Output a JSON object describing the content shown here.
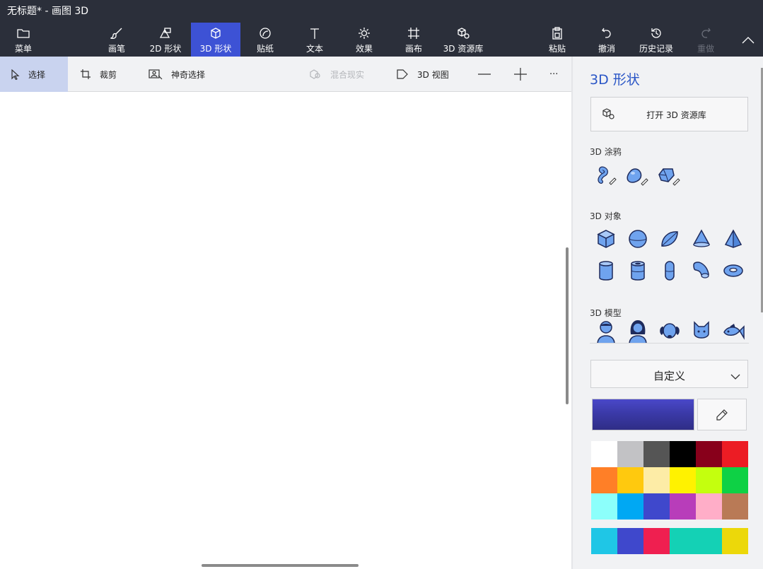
{
  "window": {
    "title": "无标题* - 画图 3D"
  },
  "ribbon": {
    "menu": {
      "label": "菜单",
      "icon": "folder-icon"
    },
    "brushes": {
      "label": "画笔",
      "icon": "brush-icon"
    },
    "shapes2d": {
      "label": "2D 形状",
      "icon": "shapes-2d-icon"
    },
    "shapes3d": {
      "label": "3D 形状",
      "icon": "cube-icon",
      "active": true
    },
    "stickers": {
      "label": "贴纸",
      "icon": "sticker-icon"
    },
    "text": {
      "label": "文本",
      "icon": "text-icon"
    },
    "effects": {
      "label": "效果",
      "icon": "sun-icon"
    },
    "canvas": {
      "label": "画布",
      "icon": "canvas-grid-icon"
    },
    "library3d": {
      "label": "3D 资源库",
      "icon": "library-3d-icon"
    },
    "paste": {
      "label": "粘贴",
      "icon": "clipboard-icon"
    },
    "undo": {
      "label": "撤消",
      "icon": "undo-icon"
    },
    "history": {
      "label": "历史记录",
      "icon": "history-icon"
    },
    "redo": {
      "label": "重做",
      "icon": "redo-icon",
      "disabled": true
    },
    "collapse": {
      "icon": "chevron-up-icon"
    }
  },
  "toolbar": {
    "select": "选择",
    "crop": "裁剪",
    "magic_select": "神奇选择",
    "mixed_reality": "混合现实",
    "view3d": "3D 视图",
    "more": "···"
  },
  "panel": {
    "title": "3D 形状",
    "open_library": "打开 3D 资源库",
    "doodles_label": "3D 涂鸦",
    "objects_label": "3D 对象",
    "models_label": "3D 模型",
    "doodles": [
      "tube-doodle-icon",
      "soft-edge-doodle-icon",
      "sharp-edge-doodle-icon"
    ],
    "objects_row1": [
      "cube-icon",
      "sphere-icon",
      "hemisphere-icon",
      "cone-icon",
      "pyramid-icon"
    ],
    "objects_row2": [
      "cylinder-icon",
      "tube-icon",
      "capsule-icon",
      "elbow-icon",
      "donut-icon"
    ],
    "models": [
      "man-model-icon",
      "woman-model-icon",
      "dog-model-icon",
      "cat-model-icon",
      "fish-model-icon"
    ],
    "material": "自定义",
    "current_color": "#3b3aa8",
    "palette": [
      "#ffffff",
      "#c2c2c5",
      "#555555",
      "#000000",
      "#88001b",
      "#ec1c24",
      "#ff7f27",
      "#ffc90e",
      "#fdeca6",
      "#fff200",
      "#c4ff0e",
      "#0ed145",
      "#8cfffb",
      "#00a8f3",
      "#3f48cc",
      "#b83dba",
      "#ffaec8",
      "#b97a56"
    ],
    "custom_colors": [
      "#1fc6e6",
      "#3f48cc",
      "#ef1f50",
      "#14d1b5",
      "#14d1b5",
      "#ecd80a"
    ]
  }
}
